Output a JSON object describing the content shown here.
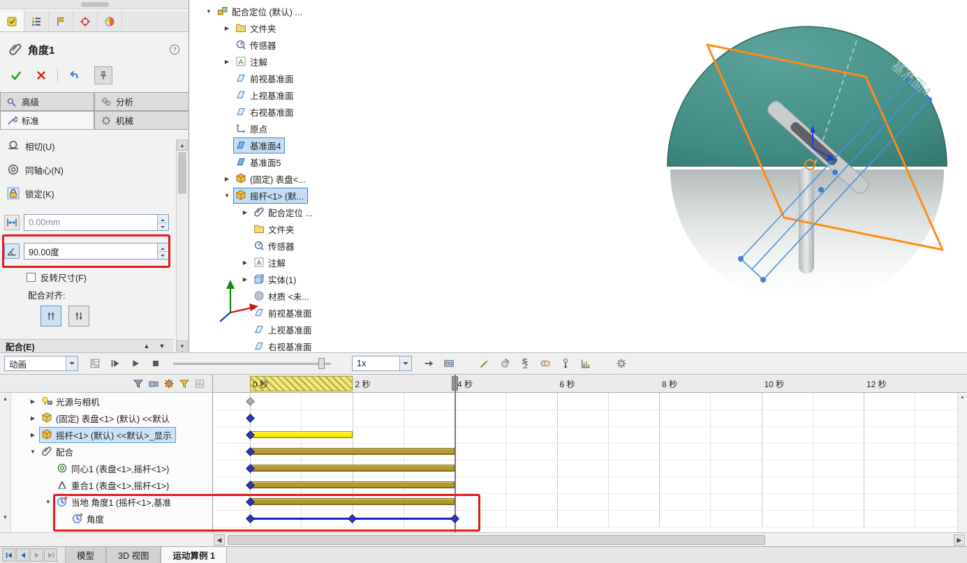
{
  "property_panel": {
    "title": "角度1",
    "panel_tabs": [
      {
        "icon": "property-manager",
        "active": true
      },
      {
        "icon": "feature-manager",
        "active": false
      },
      {
        "icon": "configuration-manager",
        "active": false
      },
      {
        "icon": "dimxpert-manager",
        "active": false
      },
      {
        "icon": "display-manager",
        "active": false
      }
    ],
    "mode_tabs": {
      "advanced": "高级",
      "analysis": "分析",
      "standard": "标准",
      "mechanical": "机械"
    },
    "mate_types": [
      {
        "id": "tangent",
        "label": "相切(U)"
      },
      {
        "id": "concentric",
        "label": "同轴心(N)"
      },
      {
        "id": "lock",
        "label": "锁定(K)"
      }
    ],
    "distance": {
      "value": "0.00mm"
    },
    "angle": {
      "value": "90.00度"
    },
    "flip_dimension": "反转尺寸(F)",
    "mate_alignment": "配合对齐:",
    "mates_section": "配合(E)"
  },
  "feature_tree": {
    "items": [
      {
        "label": "配合定位 (默认) ...",
        "icon": "assembly",
        "expand": "open",
        "level": 0,
        "selected": false
      },
      {
        "label": "文件夹",
        "icon": "folder",
        "expand": "closed",
        "level": 1,
        "selected": false
      },
      {
        "label": "传感器",
        "icon": "sensor",
        "expand": "none",
        "level": 1,
        "selected": false
      },
      {
        "label": "注解",
        "icon": "annotations",
        "expand": "closed",
        "level": 1,
        "selected": false
      },
      {
        "label": "前视基准面",
        "icon": "plane",
        "expand": "none",
        "level": 1,
        "selected": false
      },
      {
        "label": "上视基准面",
        "icon": "plane",
        "expand": "none",
        "level": 1,
        "selected": false
      },
      {
        "label": "右视基准面",
        "icon": "plane",
        "expand": "none",
        "level": 1,
        "selected": false
      },
      {
        "label": "原点",
        "icon": "origin",
        "expand": "none",
        "level": 1,
        "selected": false
      },
      {
        "label": "基准面4",
        "icon": "plane-solid",
        "expand": "none",
        "level": 1,
        "selected": true
      },
      {
        "label": "基准面5",
        "icon": "plane-solid",
        "expand": "none",
        "level": 1,
        "selected": false
      },
      {
        "label": "(固定) 表盘<...",
        "icon": "part",
        "expand": "closed",
        "level": 1,
        "selected": false
      },
      {
        "label": "摇杆<1> (默...",
        "icon": "part",
        "expand": "open",
        "level": 1,
        "selected": true
      },
      {
        "label": "配合定位 ...",
        "icon": "mates",
        "expand": "closed",
        "level": 2,
        "selected": false
      },
      {
        "label": "文件夹",
        "icon": "folder",
        "expand": "none",
        "level": 2,
        "selected": false
      },
      {
        "label": "传感器",
        "icon": "sensor",
        "expand": "none",
        "level": 2,
        "selected": false
      },
      {
        "label": "注解",
        "icon": "annotations",
        "expand": "closed",
        "level": 2,
        "selected": false
      },
      {
        "label": "实体(1)",
        "icon": "solid-body",
        "expand": "closed",
        "level": 2,
        "selected": false
      },
      {
        "label": "材质 <未...",
        "icon": "material",
        "expand": "none",
        "level": 2,
        "selected": false
      },
      {
        "label": "前视基准面",
        "icon": "plane",
        "expand": "none",
        "level": 2,
        "selected": false
      },
      {
        "label": "上视基准面",
        "icon": "plane",
        "expand": "none",
        "level": 2,
        "selected": false
      },
      {
        "label": "右视基准面",
        "icon": "plane",
        "expand": "none",
        "level": 2,
        "selected": false
      }
    ]
  },
  "viewport": {
    "plane_label": "基准面4"
  },
  "motion_toolbar": {
    "study_type": "动画",
    "speed": "1x",
    "left_icons": [
      "calculate",
      "play-from-start",
      "play",
      "stop"
    ],
    "right_icons": [
      "playback-mode",
      "save-animation",
      "animation-wizard",
      "motor",
      "spring",
      "contact",
      "gravity",
      "results-and-plots",
      "motion-study-properties"
    ]
  },
  "timeline": {
    "filter_icons": [
      "filter-none",
      "filter-animated",
      "filter-driving",
      "filter-selected",
      "filter-results"
    ],
    "ruler": [
      "0 秒",
      "2 秒",
      "4 秒",
      "6 秒",
      "8 秒",
      "10 秒",
      "12 秒"
    ],
    "seconds_per_label": 2,
    "current_time_sec": 4,
    "active_range_sec": [
      0,
      2
    ],
    "colors": {
      "olive": "#b3992f",
      "yellow": "#fff000",
      "blue": "#2a35c8",
      "gray": "#ababab",
      "line_blue": "#1420c8"
    },
    "rows": [
      {
        "label": "光源与相机",
        "icon": "lights-cameras",
        "expand": "closed",
        "level": 1,
        "selected": false,
        "keys": [
          {
            "t": 0,
            "color": "gray"
          }
        ]
      },
      {
        "label": "(固定) 表盘<1> (默认) <<默认",
        "icon": "part-fixed",
        "expand": "closed",
        "level": 1,
        "selected": false,
        "keys": [
          {
            "t": 0,
            "color": "blue"
          }
        ]
      },
      {
        "label": "摇杆<1> (默认) <<默认>_显示",
        "icon": "part",
        "expand": "closed",
        "level": 1,
        "selected": true,
        "bar": {
          "from": 0,
          "to": 2,
          "color": "yellow"
        },
        "keys": [
          {
            "t": 0,
            "color": "blue"
          }
        ]
      },
      {
        "label": "配合",
        "icon": "mates",
        "expand": "open",
        "level": 1,
        "selected": false,
        "bar": {
          "from": 0,
          "to": 4,
          "color": "olive"
        },
        "keys": [
          {
            "t": 0,
            "color": "blue"
          }
        ]
      },
      {
        "label": "同心1 (表盘<1>,摇杆<1>)",
        "icon": "concentric-mate",
        "expand": "none",
        "level": 2,
        "selected": false,
        "bar": {
          "from": 0,
          "to": 4,
          "color": "olive"
        },
        "keys": [
          {
            "t": 0,
            "color": "blue"
          }
        ]
      },
      {
        "label": "重合1 (表盘<1>,摇杆<1>)",
        "icon": "coincident-mate",
        "expand": "none",
        "level": 2,
        "selected": false,
        "bar": {
          "from": 0,
          "to": 4,
          "color": "olive"
        },
        "keys": [
          {
            "t": 0,
            "color": "blue"
          }
        ]
      },
      {
        "label": "当地 角度1 (摇杆<1>,基准",
        "icon": "angle-mate",
        "expand": "open",
        "level": 2,
        "selected": false,
        "bar": {
          "from": 0,
          "to": 4,
          "color": "olive"
        },
        "keys": [
          {
            "t": 0,
            "color": "blue"
          }
        ]
      },
      {
        "label": "角度",
        "icon": "angle-mate",
        "expand": "none",
        "level": 3,
        "selected": false,
        "line": {
          "from": 0,
          "to": 4
        },
        "keys": [
          {
            "t": 0,
            "color": "blue"
          },
          {
            "t": 2,
            "color": "blue"
          },
          {
            "t": 4,
            "color": "blue"
          }
        ]
      }
    ]
  },
  "bottom_bar": {
    "nav_icons": [
      "first-tab",
      "previous-tab",
      "next-tab",
      "last-tab"
    ],
    "tabs": [
      {
        "label": "模型",
        "active": false
      },
      {
        "label": "3D 视图",
        "active": false
      },
      {
        "label": "运动算例 1",
        "active": true
      }
    ]
  },
  "ui_colors": {
    "annotation": "#e11b1b",
    "selection": "#cde3f8"
  }
}
